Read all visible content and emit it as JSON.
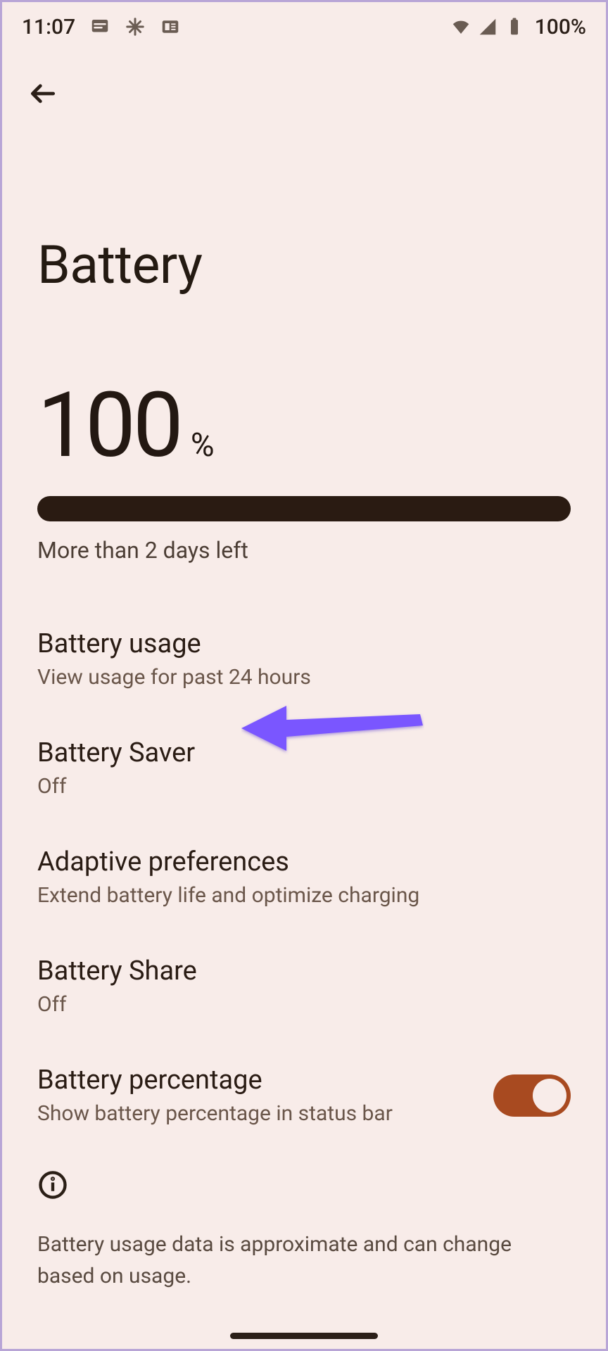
{
  "status": {
    "time": "11:07",
    "battery_pct": "100%"
  },
  "page": {
    "title": "Battery",
    "level_value": "100",
    "level_unit": "%",
    "estimate": "More than 2 days left"
  },
  "settings": [
    {
      "title": "Battery usage",
      "sub": "View usage for past 24 hours"
    },
    {
      "title": "Battery Saver",
      "sub": "Off"
    },
    {
      "title": "Adaptive preferences",
      "sub": "Extend battery life and optimize charging"
    },
    {
      "title": "Battery Share",
      "sub": "Off"
    },
    {
      "title": "Battery percentage",
      "sub": "Show battery percentage in status bar",
      "toggle": true
    }
  ],
  "info": {
    "text": "Battery usage data is approximate and can change based on usage."
  },
  "annotation": {
    "color": "#7a57ff"
  }
}
